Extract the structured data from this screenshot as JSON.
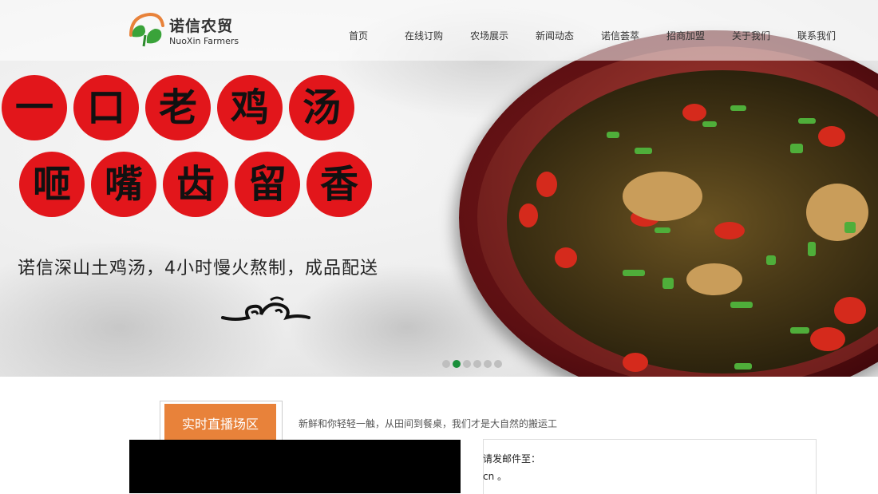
{
  "header": {
    "logo_cn": "诺信农贸",
    "logo_en": "NuoXin Farmers",
    "nav": [
      "首页",
      "在线订购",
      "农场展示",
      "新闻动态",
      "诺信荟萃",
      "招商加盟",
      "关于我们",
      "联系我们"
    ]
  },
  "hero": {
    "line1": [
      "一",
      "口",
      "老",
      "鸡",
      "汤"
    ],
    "line2": [
      "咂",
      "嘴",
      "齿",
      "留",
      "香"
    ],
    "slogan": "诺信深山土鸡汤，4小时慢火熬制，成品配送",
    "slides_count": 6,
    "active_slide": 2
  },
  "live": {
    "tab_label": "实时直播场区",
    "tagline": "新鲜和你轻轻一触，从田间到餐桌，我们才是大自然的搬运工"
  },
  "info": {
    "line1": "请发邮件至：",
    "line2": "cn 。"
  },
  "colors": {
    "accent_orange": "#e8823a",
    "circle_red": "#e2161b",
    "active_dot": "#1a8f3a"
  }
}
